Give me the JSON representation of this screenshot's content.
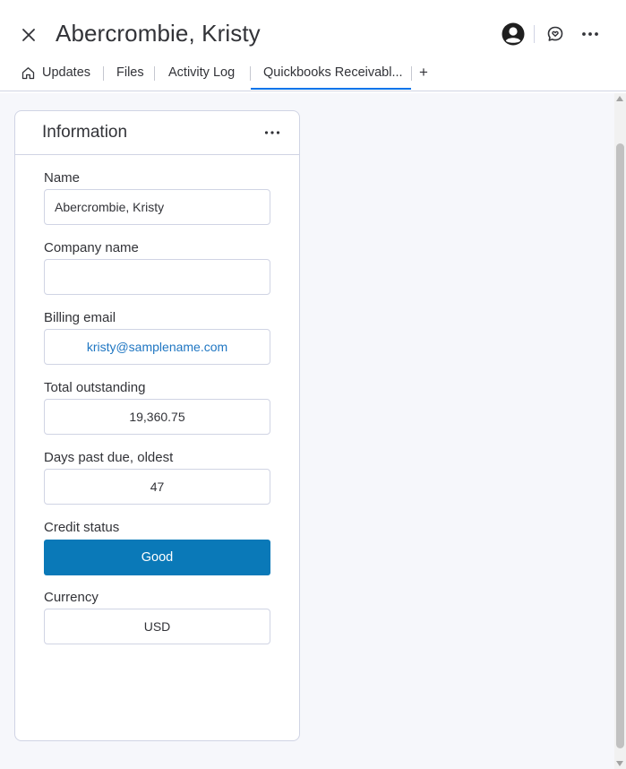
{
  "header": {
    "title": "Abercrombie, Kristy",
    "close_icon": "close-icon",
    "avatar_icon": "user-avatar-icon",
    "chat_icon": "chat-heart-icon",
    "more_icon": "more-horizontal-icon"
  },
  "tabs": [
    {
      "label": "Updates",
      "icon": "home-icon"
    },
    {
      "label": "Files"
    },
    {
      "label": "Activity Log"
    },
    {
      "label": "Quickbooks Receivabl...",
      "active": true
    }
  ],
  "add_tab_label": "+",
  "card": {
    "title": "Information",
    "more_icon": "more-horizontal-icon"
  },
  "fields": {
    "name": {
      "label": "Name",
      "value": "Abercrombie, Kristy"
    },
    "company": {
      "label": "Company name",
      "value": ""
    },
    "billing_email": {
      "label": "Billing email",
      "value": "kristy@samplename.com"
    },
    "total_outstanding": {
      "label": "Total outstanding",
      "value": "19,360.75"
    },
    "days_past_due": {
      "label": "Days past due, oldest",
      "value": "47"
    },
    "credit_status": {
      "label": "Credit status",
      "value": "Good"
    },
    "currency": {
      "label": "Currency",
      "value": "USD"
    }
  },
  "colors": {
    "accent": "#0073ea",
    "status_good": "#0a79b8",
    "email_link": "#1f76c2"
  }
}
